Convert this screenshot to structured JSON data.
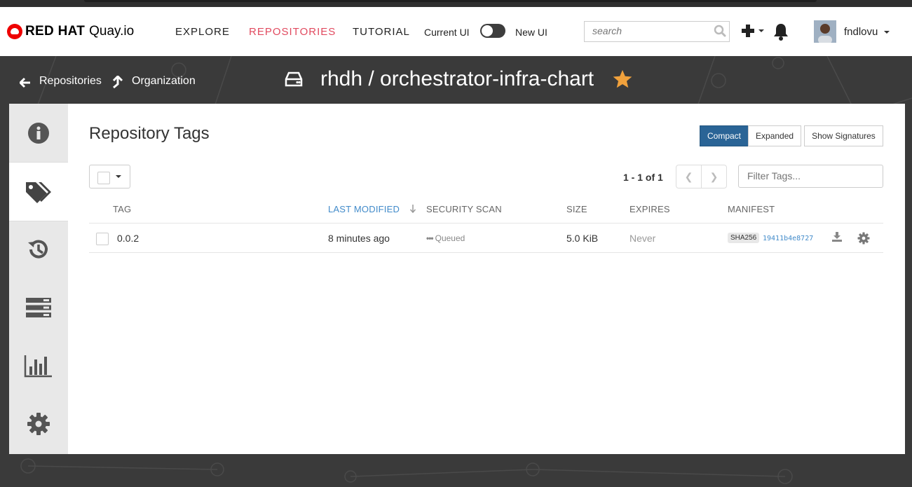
{
  "navbar": {
    "brand_red_hat": "RED HAT",
    "brand_product": "Quay.io",
    "links": [
      "EXPLORE",
      "REPOSITORIES",
      "TUTORIAL"
    ],
    "active_link": "REPOSITORIES",
    "current_ui_label": "Current UI",
    "new_ui_label": "New UI",
    "search_placeholder": "search",
    "username": "fndlovu",
    "icons": [
      "plus-icon",
      "bell-icon",
      "search-icon"
    ]
  },
  "header": {
    "back_link": "Repositories",
    "org_link": "Organization",
    "repo_title": "rhdh / orchestrator-infra-chart",
    "starred": true
  },
  "sidebar": {
    "items": [
      {
        "icon": "info-icon"
      },
      {
        "icon": "tags-icon",
        "active": true
      },
      {
        "icon": "history-icon"
      },
      {
        "icon": "builds-icon"
      },
      {
        "icon": "usage-logs-icon"
      },
      {
        "icon": "settings-icon"
      }
    ]
  },
  "tags_view": {
    "title": "Repository Tags",
    "view_buttons": [
      "Compact",
      "Expanded",
      "Show Signatures"
    ],
    "active_view": "Compact",
    "pagination_text": "1 - 1 of 1",
    "filter_placeholder": "Filter Tags...",
    "columns": [
      "TAG",
      "LAST MODIFIED",
      "SECURITY SCAN",
      "SIZE",
      "EXPIRES",
      "MANIFEST"
    ],
    "sorted_column": "LAST MODIFIED",
    "rows": [
      {
        "tag": "0.0.2",
        "last_modified": "8 minutes ago",
        "security_scan": "Queued",
        "size": "5.0 KiB",
        "expires": "Never",
        "manifest_algo": "SHA256",
        "manifest_digest": "19411b4e8727"
      }
    ]
  },
  "colors": {
    "accent_red": "#e14a5f",
    "primary_blue": "#2a6496",
    "link_blue": "#428bca",
    "star": "#f0a13c",
    "header_bg": "#3a3a3a"
  }
}
